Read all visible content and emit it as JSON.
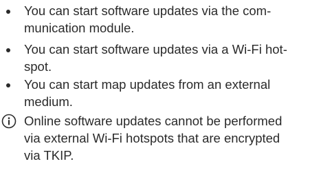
{
  "bullets": [
    {
      "lines": [
        "You can start software updates via the com-",
        "munication module."
      ]
    },
    {
      "lines": [
        "You can start software updates via a Wi-Fi hot-",
        "spot."
      ]
    },
    {
      "lines": [
        "You can start map updates from an external",
        "medium."
      ]
    }
  ],
  "note": {
    "icon": "info-icon",
    "lines": [
      "Online software updates cannot be performed",
      "via external Wi-Fi hotspots that are encrypted",
      "via TKIP."
    ]
  },
  "colors": {
    "text": "#2a2a2a",
    "background": "#ffffff"
  }
}
